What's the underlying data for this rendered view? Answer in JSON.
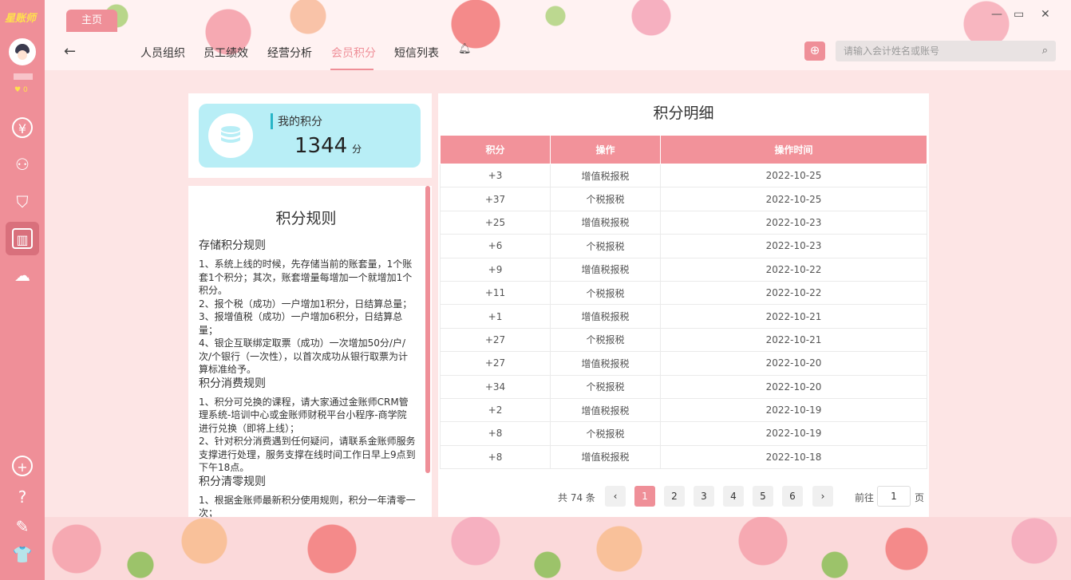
{
  "app": {
    "logo": "星账师",
    "home_tab": "主页",
    "coins": "0"
  },
  "nav": {
    "items": [
      "人员组织",
      "员工绩效",
      "经营分析",
      "会员积分",
      "短信列表"
    ],
    "active_index": 3,
    "search_placeholder": "请输入会计姓名或账号"
  },
  "score": {
    "label": "我的积分",
    "value": "1344",
    "unit": "分"
  },
  "rules": {
    "title": "积分规则",
    "sections": [
      {
        "heading": "存储积分规则",
        "text": "1、系统上线的时候，先存储当前的账套量，1个账套1个积分；其次，账套增量每增加一个就增加1个积分。\n2、报个税（成功）一户增加1积分，日结算总量；\n3、报增值税（成功）一户增加6积分，日结算总量；\n4、银企互联绑定取票（成功）一次增加50分/户/次/个银行（一次性），以首次成功从银行取票为计算标准给予。"
      },
      {
        "heading": "积分消费规则",
        "text": "1、积分可兑换的课程，请大家通过金账师CRM管理系统-培训中心或金账师财税平台小程序-商学院进行兑换（即将上线）；\n2、针对积分消费遇到任何疑问，请联系金账师服务支撑进行处理，服务支撑在线时间工作日早上9点到下午18点。"
      },
      {
        "heading": "积分清零规则",
        "text": "1、根据金账师最新积分使用规则，积分一年清零一次；"
      }
    ]
  },
  "detail": {
    "title": "积分明细",
    "headers": [
      "积分",
      "操作",
      "操作时间"
    ],
    "rows": [
      [
        "+3",
        "增值税报税",
        "2022-10-25"
      ],
      [
        "+37",
        "个税报税",
        "2022-10-25"
      ],
      [
        "+25",
        "增值税报税",
        "2022-10-23"
      ],
      [
        "+6",
        "个税报税",
        "2022-10-23"
      ],
      [
        "+9",
        "增值税报税",
        "2022-10-22"
      ],
      [
        "+11",
        "个税报税",
        "2022-10-22"
      ],
      [
        "+1",
        "增值税报税",
        "2022-10-21"
      ],
      [
        "+27",
        "个税报税",
        "2022-10-21"
      ],
      [
        "+27",
        "增值税报税",
        "2022-10-20"
      ],
      [
        "+34",
        "个税报税",
        "2022-10-20"
      ],
      [
        "+2",
        "增值税报税",
        "2022-10-19"
      ],
      [
        "+8",
        "个税报税",
        "2022-10-19"
      ],
      [
        "+8",
        "增值税报税",
        "2022-10-18"
      ]
    ]
  },
  "pager": {
    "total": "共 74 条",
    "pages": [
      "1",
      "2",
      "3",
      "4",
      "5",
      "6"
    ],
    "current": "1",
    "goto_label": "前往",
    "goto_value": "1",
    "goto_unit": "页"
  },
  "colors": {
    "accent": "#ef8f98",
    "card": "#b8eef6",
    "score_bar": "#28b5c7"
  }
}
